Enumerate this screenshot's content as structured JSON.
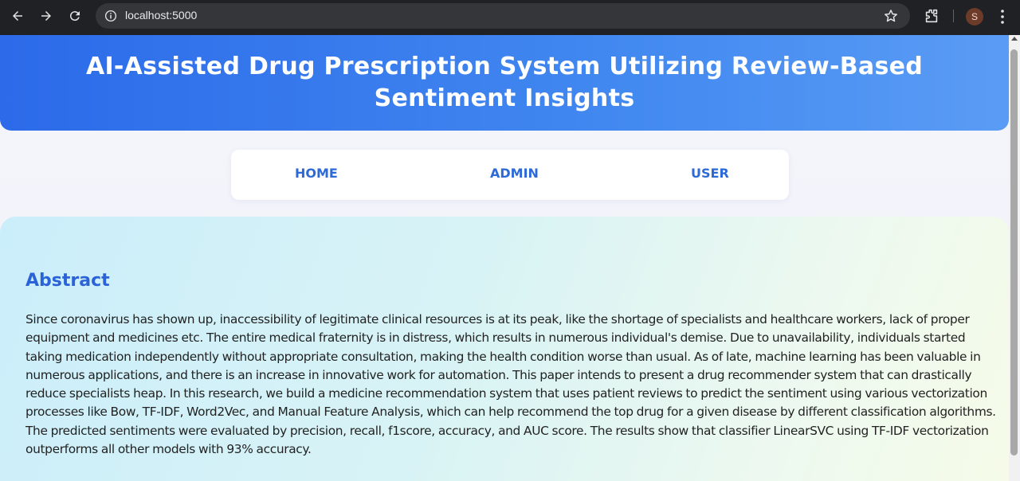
{
  "browser": {
    "url": "localhost:5000",
    "profile_initial": "S",
    "icons": {
      "back": "arrow-left-icon",
      "forward": "arrow-right-icon",
      "reload": "reload-icon",
      "site_info": "info-icon",
      "bookmark": "star-icon",
      "extensions": "puzzle-icon",
      "menu": "kebab-menu-icon"
    }
  },
  "header": {
    "title": "AI-Assisted Drug Prescription System Utilizing Review-Based Sentiment Insights"
  },
  "nav": {
    "items": [
      {
        "label": "HOME"
      },
      {
        "label": "ADMIN"
      },
      {
        "label": "USER"
      }
    ]
  },
  "abstract": {
    "heading": "Abstract",
    "body": "Since coronavirus has shown up, inaccessibility of legitimate clinical resources is at its peak, like the shortage of specialists and healthcare workers, lack of proper equipment and medicines etc. The entire medical fraternity is in distress, which results in numerous individual's demise. Due to unavailability, individuals started taking medication independently without appropriate consultation, making the health condition worse than usual. As of late, machine learning has been valuable in numerous applications, and there is an increase in innovative work for automation. This paper intends to present a drug recommender system that can drastically reduce specialists heap. In this research, we build a medicine recommendation system that uses patient reviews to predict the sentiment using various vectorization processes like Bow, TF-IDF, Word2Vec, and Manual Feature Analysis, which can help recommend the top drug for a given disease by different classification algorithms. The predicted sentiments were evaluated by precision, recall, f1score, accuracy, and AUC score. The results show that classifier LinearSVC using TF-IDF vectorization outperforms all other models with 93% accuracy."
  },
  "colors": {
    "header_gradient_start": "#2c6ae9",
    "header_gradient_end": "#5a9cf5",
    "nav_link": "#2d6ad8",
    "abstract_heading": "#2b63d6",
    "body_text": "#222222"
  }
}
